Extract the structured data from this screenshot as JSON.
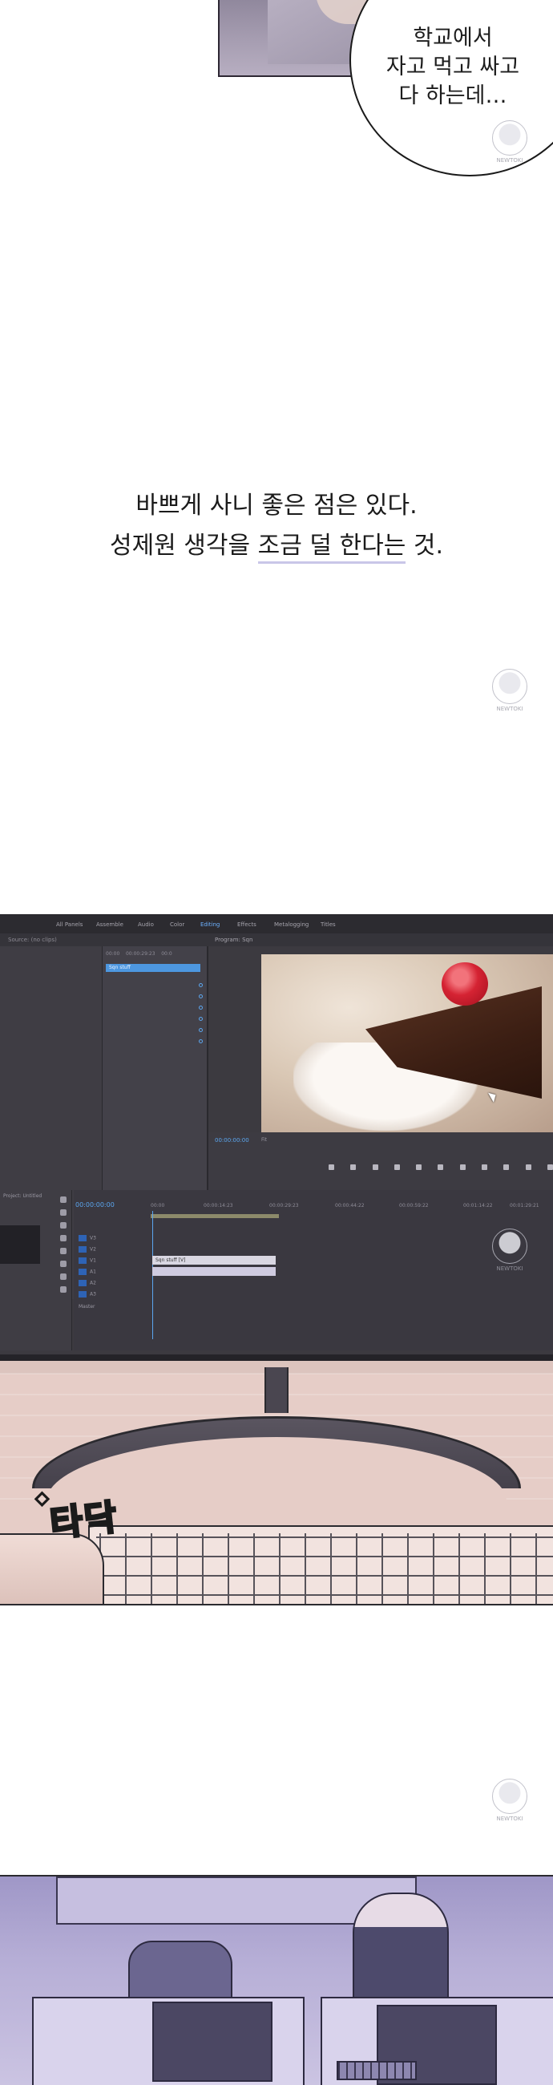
{
  "top_panel": {
    "speech_bubble": {
      "lines": [
        "학교에서",
        "자고 먹고 싸고",
        "다 하는데…"
      ]
    }
  },
  "narration": {
    "line1": "바쁘게 사니 좋은 점은 있다.",
    "line2_prefix": "성제원 생각을 ",
    "line2_accent": "조금 덜 한다는",
    "line2_suffix": " 것."
  },
  "monitor_panel": {
    "menu_items": [
      "All Panels",
      "Assemble",
      "Audio",
      "Color",
      "Editing",
      "Effects",
      "Metalogging",
      "Titles"
    ],
    "active_menu": "Editing",
    "source_label": "Source: (no clips)",
    "program_label": "Program: Sqn",
    "sequence_timecodes": [
      "00:00",
      "00:00:29:23",
      "00:0"
    ],
    "clip_name": "Sqn stuff",
    "program_timecode": "00:00:00:00",
    "program_fit": "Fit",
    "project_label": "Project: Untitled",
    "timeline_timecode": "00:00:00:00",
    "ruler_ticks": [
      "00:00",
      "00:00:14:23",
      "00:00:29:23",
      "00:00:44:22",
      "00:00:59:22",
      "00:01:14:22",
      "00:01:29:21"
    ],
    "tracks": [
      "V3",
      "V2",
      "V1",
      "A1",
      "A2",
      "A3",
      "Master"
    ],
    "timeline_clip": "Sqn stuff [V]",
    "sound_effect": "타닥",
    "sound_effect_mark": "◇"
  },
  "watermark_text": "NEWTOKI"
}
